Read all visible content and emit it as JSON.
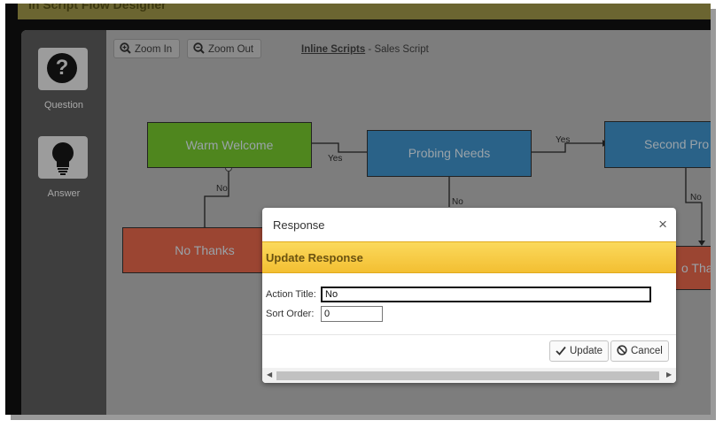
{
  "header": {
    "title": "In Script Flow Designer"
  },
  "toolbox": {
    "question": {
      "icon": "question-icon",
      "label": "Question"
    },
    "answer": {
      "icon": "lightbulb-icon",
      "label": "Answer"
    }
  },
  "toolbar": {
    "zoom_in_label": "Zoom In",
    "zoom_out_label": "Zoom Out",
    "breadcrumb_link": "Inline Scripts",
    "breadcrumb_rest": " - Sales Script"
  },
  "flow": {
    "nodes": {
      "warm_welcome": "Warm Welcome",
      "probing_needs": "Probing Needs",
      "second_prompt": "Second Pro",
      "no_thanks_left": "No Thanks",
      "no_thanks_right": "o Tha"
    },
    "edges": {
      "welcome_yes": "Yes",
      "welcome_no": "No",
      "probing_yes": "Yes",
      "probing_no": "No",
      "second_no": "No"
    },
    "colors": {
      "green_node": "#4f861e",
      "blue_node": "#2a6288",
      "red_node": "#9b4532"
    }
  },
  "modal": {
    "title": "Response",
    "close_icon": "close-icon",
    "banner": "Update Response",
    "action_title_label": "Action Title:",
    "action_title_value": "No",
    "sort_order_label": "Sort Order:",
    "sort_order_value": "0",
    "update_label": "Update",
    "cancel_label": "Cancel",
    "accent_color": "#f3bf32"
  }
}
